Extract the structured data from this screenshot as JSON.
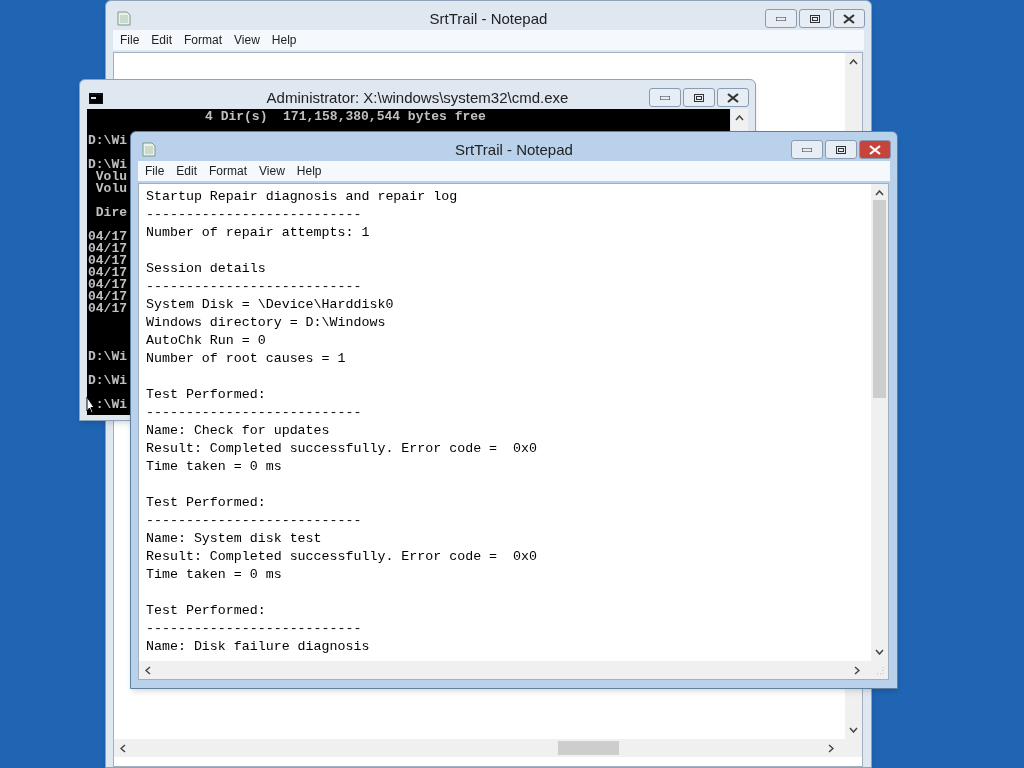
{
  "windows": [
    {
      "kind": "notepad",
      "title": "SrtTrail - Notepad",
      "active": false,
      "menu": [
        "File",
        "Edit",
        "Format",
        "View",
        "Help"
      ]
    },
    {
      "kind": "console",
      "title": "Administrator: X:\\windows\\system32\\cmd.exe",
      "active": false,
      "text": "               4 Dir(s)  171,158,380,544 bytes free\n\nD:\\Wi\n\nD:\\Wi\n Volu\n Volu\n\n Dire\n\n04/17\n04/17\n04/17\n04/17\n04/17\n04/17\n04/17\n\n\n\nD:\\Wi\n\nD:\\Wi\n\n :\\Wi"
    },
    {
      "kind": "notepad",
      "title": "SrtTrail - Notepad",
      "active": true,
      "menu": [
        "File",
        "Edit",
        "Format",
        "View",
        "Help"
      ],
      "text": "Startup Repair diagnosis and repair log\n---------------------------\nNumber of repair attempts: 1\n\nSession details\n---------------------------\nSystem Disk = \\Device\\Harddisk0\nWindows directory = D:\\Windows\nAutoChk Run = 0\nNumber of root causes = 1\n\nTest Performed:\n---------------------------\nName: Check for updates\nResult: Completed successfully. Error code =  0x0\nTime taken = 0 ms\n\nTest Performed:\n---------------------------\nName: System disk test\nResult: Completed successfully. Error code =  0x0\nTime taken = 0 ms\n\nTest Performed:\n---------------------------\nName: Disk failure diagnosis"
    }
  ]
}
